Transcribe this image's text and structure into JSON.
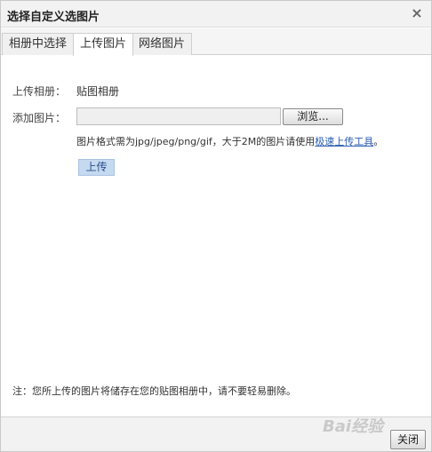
{
  "dialog": {
    "title": "选择自定义选图片",
    "close_symbol": "×"
  },
  "tabs": [
    {
      "label": "相册中选择",
      "active": false
    },
    {
      "label": "上传图片",
      "active": true
    },
    {
      "label": "网络图片",
      "active": false
    }
  ],
  "form": {
    "album_label": "上传相册：",
    "album_value": "贴图相册",
    "add_label": "添加图片：",
    "file_input_value": "",
    "browse_label": "浏览...",
    "hint_text": "图片格式需为jpg/jpeg/png/gif，大于2M的图片请使用",
    "hint_link": "极速上传工具",
    "hint_end": "。",
    "upload_label": "上传"
  },
  "note": "注：您所上传的图片将储存在您的贴图相册中，请不要轻易删除。",
  "footer": {
    "close_label": "关闭"
  },
  "watermark": "Bai经验"
}
